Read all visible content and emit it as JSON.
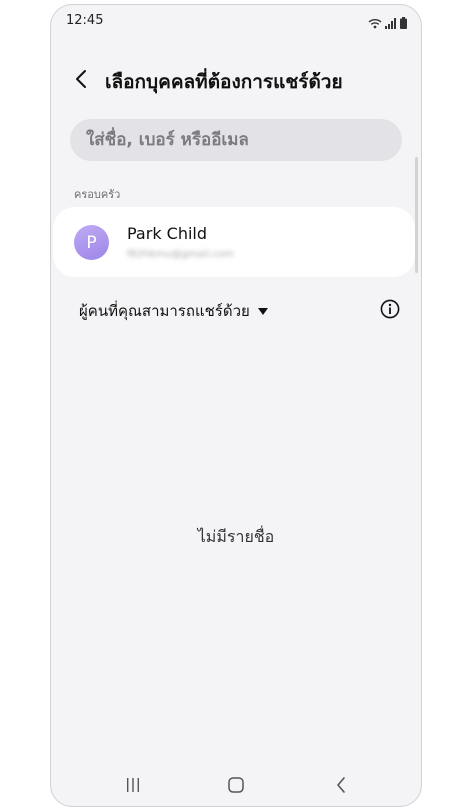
{
  "status_bar": {
    "time": "12:45",
    "icons": [
      "wifi-icon",
      "signal-icon",
      "battery-icon"
    ]
  },
  "header": {
    "title": "เลือกบุคคลที่ต้องการแชร์ด้วย",
    "back_icon": "chevron-left-icon"
  },
  "search": {
    "placeholder": "ใส่ชื่อ, เบอร์ หรืออีเมล",
    "value": ""
  },
  "family_section": {
    "label": "ครอบครัว",
    "contacts": [
      {
        "initial": "P",
        "name": "Park Child",
        "email": "f82hkmu@gmail.com"
      }
    ]
  },
  "dropdown": {
    "label": "ผู้คนที่คุณสามารถแชร์ด้วย",
    "icon": "caret-down-icon"
  },
  "info_icon": "info-icon",
  "empty_state": {
    "text": "ไม่มีรายชื่อ"
  },
  "nav_bar": {
    "icons": [
      "recents-icon",
      "home-icon",
      "back-icon"
    ]
  },
  "colors": {
    "background": "#f4f4f6",
    "card": "#ffffff",
    "avatar_from": "#bfaaf3",
    "avatar_to": "#9d86e8",
    "search_bg": "#e3e3e7"
  }
}
